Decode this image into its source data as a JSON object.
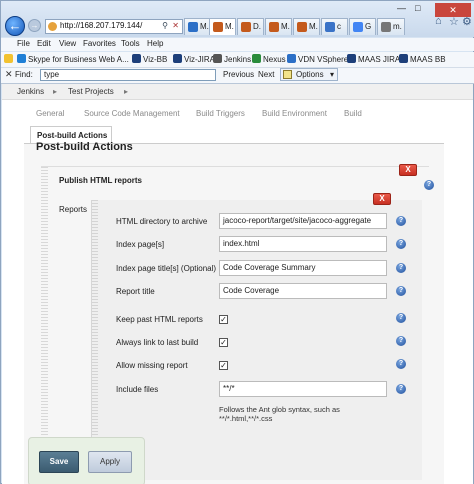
{
  "browser": {
    "url": "http://168.207.179.144/",
    "tabs": [
      {
        "label": "M.",
        "color": "#2b6fc7",
        "active": false
      },
      {
        "label": "M.",
        "color": "#c45a1c",
        "active": true
      },
      {
        "label": "D.",
        "color": "#c45a1c",
        "active": false
      },
      {
        "label": "M.",
        "color": "#c45a1c",
        "active": false
      },
      {
        "label": "M.",
        "color": "#c45a1c",
        "active": false
      },
      {
        "label": "c",
        "color": "#3a73c7",
        "active": false
      },
      {
        "label": "G",
        "color": "#4285f4",
        "active": false
      },
      {
        "label": "m.",
        "color": "#777777",
        "active": false
      }
    ],
    "menu": [
      "File",
      "Edit",
      "View",
      "Favorites",
      "Tools",
      "Help"
    ],
    "favorites": [
      {
        "label": "Skype for Business Web A...",
        "color": "#1f7fd6"
      },
      {
        "label": "Viz-BB",
        "color": "#1d3f7a"
      },
      {
        "label": "Viz-JIRA",
        "color": "#1d3f7a"
      },
      {
        "label": "Jenkins",
        "color": "#555555"
      },
      {
        "label": "Nexus",
        "color": "#2a8c3c"
      },
      {
        "label": "VDN VSphere",
        "color": "#2b6fc7"
      },
      {
        "label": "MAAS JIRA",
        "color": "#1d3f7a"
      },
      {
        "label": "MAAS BB",
        "color": "#1d3f7a"
      }
    ],
    "find": {
      "label": "Find:",
      "value": "type",
      "previous": "Previous",
      "next": "Next",
      "options": "Options"
    }
  },
  "breadcrumb": [
    "Jenkins",
    "Test Projects"
  ],
  "config_tabs": [
    "General",
    "Source Code Management",
    "Build Triggers",
    "Build Environment",
    "Build"
  ],
  "active_tab": "Post-build Actions",
  "section_title": "Post-build Actions",
  "publisher": {
    "title": "Publish HTML reports",
    "delete_label": "X",
    "reports_label": "Reports",
    "fields": [
      {
        "label": "HTML directory to archive",
        "value": "jacoco-report/target/site/jacoco-aggregate"
      },
      {
        "label": "Index page[s]",
        "value": "index.html"
      },
      {
        "label": "Index page title[s] (Optional)",
        "value": "Code Coverage Summary"
      },
      {
        "label": "Report title",
        "value": "Code Coverage"
      }
    ],
    "checkboxes": [
      {
        "label": "Keep past HTML reports",
        "checked": true
      },
      {
        "label": "Always link to last build",
        "checked": true
      },
      {
        "label": "Allow missing report",
        "checked": true
      }
    ],
    "include_files": {
      "label": "Include files",
      "value": "**/*",
      "hint": "Follows the Ant glob syntax, such as **/*.html,**/*.css"
    }
  },
  "buttons": {
    "save": "Save",
    "apply": "Apply"
  }
}
